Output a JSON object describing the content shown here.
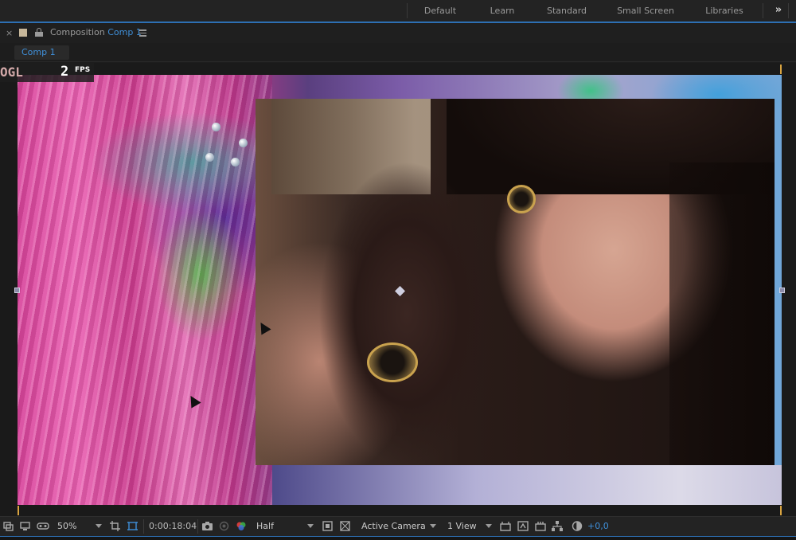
{
  "workspaces": {
    "items": [
      "Default",
      "Learn",
      "Standard",
      "Small Screen",
      "Libraries"
    ],
    "more": "»"
  },
  "panel": {
    "close": "×",
    "title_prefix": "Composition",
    "comp_name": "Comp 1",
    "tab_label": "Comp 1"
  },
  "hud": {
    "renderer": "OGL",
    "fps_value": "2",
    "fps_label": "FPS"
  },
  "toolbar": {
    "zoom": "50%",
    "timecode": "0:00:18:04",
    "resolution": "Half",
    "camera": "Active Camera",
    "views": "1 View",
    "exposure": "+0,0"
  },
  "colors": {
    "accent": "#3f8fd8",
    "workspace_line": "#2d6fb3",
    "bounds_marker": "#d9a441"
  },
  "icons": [
    "close-icon",
    "comp-color-swatch",
    "lock-icon",
    "panel-menu-icon",
    "more-workspaces-icon",
    "always-preview-icon",
    "monitor-icon",
    "vr-goggles-icon",
    "region-of-interest-icon",
    "transparency-grid-icon",
    "snapshot-icon",
    "show-snapshot-icon",
    "color-channels-icon",
    "fast-preview-icon",
    "toggle-mask-icon",
    "3d-view-icon",
    "flowchart-icon",
    "reset-exposure-icon"
  ]
}
